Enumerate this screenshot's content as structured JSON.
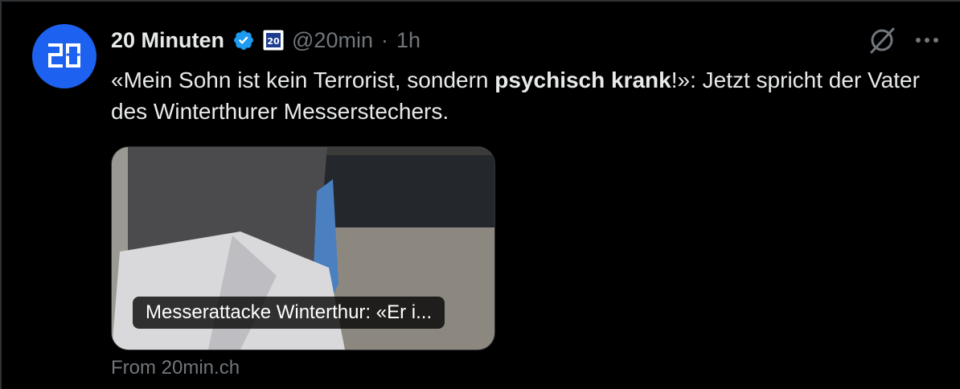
{
  "account": {
    "name": "20 Minuten",
    "handle": "@20min",
    "separator": "·",
    "time": "1h",
    "avatar_text": "20",
    "brand_color": "#1d61f0"
  },
  "post": {
    "text_before": "«Mein Sohn ist kein Terrorist, sondern ",
    "text_bold": "psychisch krank",
    "text_after": "!»: Jetzt spricht der Vater des Winterthurer Messerstechers."
  },
  "card": {
    "title": "Messerattacke Winterthur: «Er i...",
    "source": "From 20min.ch"
  },
  "icons": {
    "verified": "verified-badge-icon",
    "affiliate": "affiliate-badge-icon",
    "grok": "grok-icon",
    "more": "more-icon"
  },
  "colors": {
    "background": "#000000",
    "text": "#e7e9ea",
    "secondary_text": "#71767b",
    "verified_blue": "#1d9bf0"
  }
}
